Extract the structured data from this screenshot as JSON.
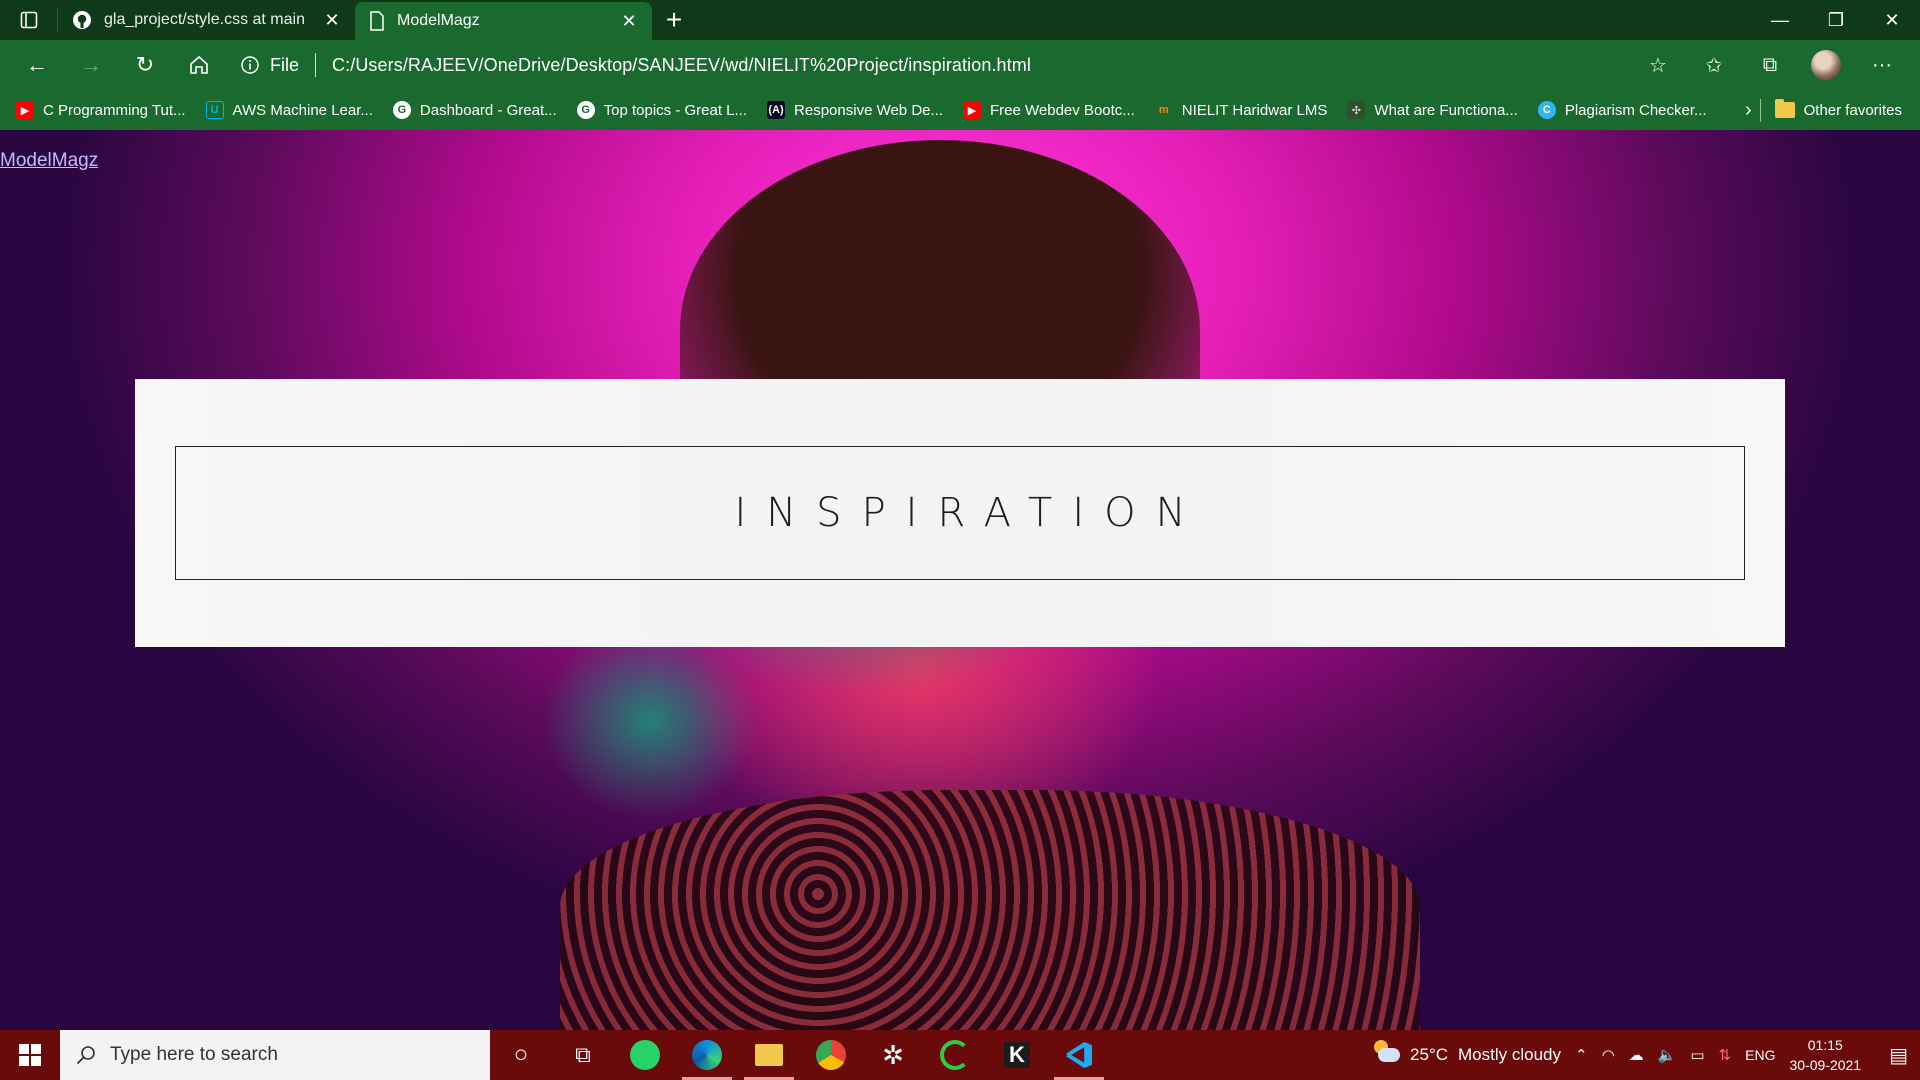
{
  "browser": {
    "tabs": [
      {
        "label": "gla_project/style.css at main · AM",
        "icon": "github-icon",
        "active": false
      },
      {
        "label": "ModelMagz",
        "icon": "page-icon",
        "active": true
      }
    ],
    "address": {
      "scheme_label": "File",
      "url": "C:/Users/RAJEEV/OneDrive/Desktop/SANJEEV/wd/NIELIT%20Project/inspiration.html"
    },
    "favorites": [
      {
        "label": "C Programming Tut...",
        "icon": "youtube-icon",
        "color": "#ff0000"
      },
      {
        "label": "AWS Machine Lear...",
        "icon": "udacity-icon",
        "color": "#02b3e4"
      },
      {
        "label": "Dashboard - Great...",
        "icon": "greatlearning-icon",
        "color": "#ffffff"
      },
      {
        "label": "Top topics - Great L...",
        "icon": "greatlearning-icon",
        "color": "#ffffff"
      },
      {
        "label": "Responsive Web De...",
        "icon": "freecodecamp-icon",
        "color": "#0a0a23"
      },
      {
        "label": "Free Webdev Bootc...",
        "icon": "youtube-icon",
        "color": "#ff0000"
      },
      {
        "label": "NIELIT Haridwar LMS",
        "icon": "moodle-icon",
        "color": "#f98012"
      },
      {
        "label": "What are Functiona...",
        "icon": "site-icon",
        "color": "#2f4f2f"
      },
      {
        "label": "Plagiarism Checker...",
        "icon": "plagiarism-icon",
        "color": "#2db7f5"
      }
    ],
    "other_favorites_label": "Other favorites"
  },
  "page": {
    "brand": "ModelMagz",
    "hero_title": "INSPIRATION"
  },
  "taskbar": {
    "search_placeholder": "Type here to search",
    "weather": {
      "temperature": "25°C",
      "condition": "Mostly cloudy"
    },
    "language": "ENG",
    "time": "01:15",
    "date": "30-09-2021"
  }
}
